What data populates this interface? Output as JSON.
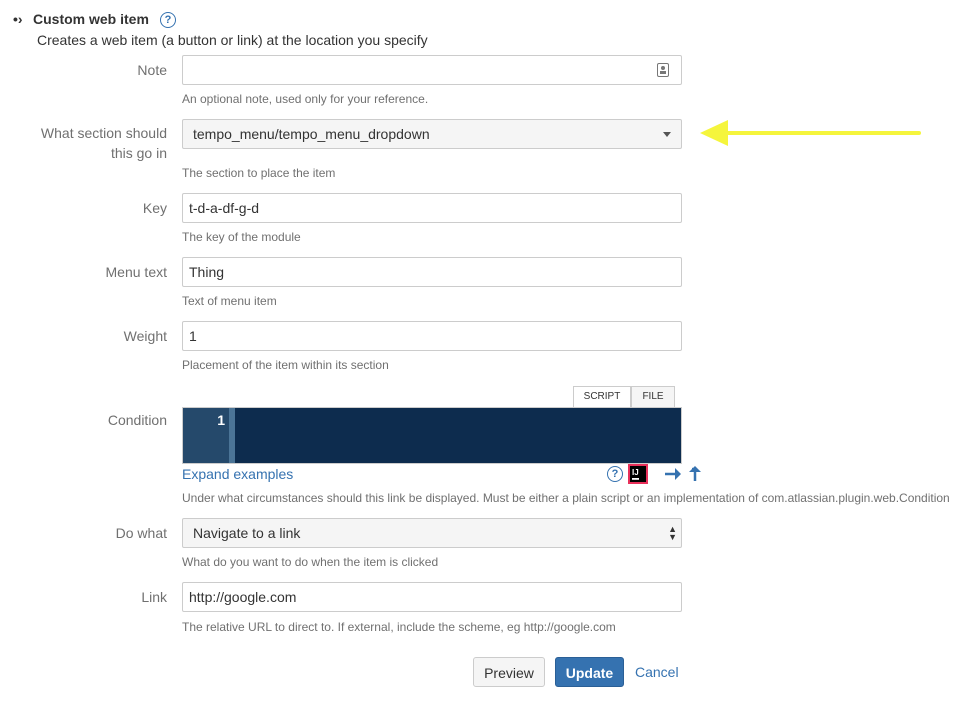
{
  "section": {
    "title": "Custom web item",
    "description": "Creates a web item (a button or link) at the location you specify",
    "help_glyph": "?"
  },
  "fields": {
    "note": {
      "label": "Note",
      "value": "",
      "description": "An optional note, used only for your reference."
    },
    "section": {
      "label_line1": "What section should",
      "label_line2": "this go in",
      "value": "tempo_menu/tempo_menu_dropdown",
      "description": "The section to place the item"
    },
    "key": {
      "label": "Key",
      "value": "t-d-a-df-g-d",
      "description": "The key of the module"
    },
    "menu_text": {
      "label": "Menu text",
      "value": "Thing",
      "description": "Text of menu item"
    },
    "weight": {
      "label": "Weight",
      "value": "1",
      "description": "Placement of the item within its section"
    },
    "condition": {
      "label": "Condition",
      "tabs": [
        "SCRIPT",
        "FILE"
      ],
      "line_number": "1",
      "expand_examples": "Expand examples",
      "description": "Under what circumstances should this link be displayed. Must be either a plain script or an implementation of com.atlassian.plugin.web.Condition"
    },
    "do_what": {
      "label": "Do what",
      "value": "Navigate to a link",
      "description": "What do you want to do when the item is clicked"
    },
    "link": {
      "label": "Link",
      "value": "http://google.com",
      "description": "The relative URL to direct to. If external, include the scheme, eg http://google.com"
    }
  },
  "buttons": {
    "preview": "Preview",
    "update": "Update",
    "cancel": "Cancel"
  },
  "icons": [
    "collapse-arrow-icon",
    "help-icon",
    "contacts-icon",
    "chevron-down-icon",
    "intellij-icon",
    "arrow-right-icon",
    "arrow-return-icon"
  ],
  "colors": {
    "accent": "#3572b0",
    "editor_bg": "#0d2c4e",
    "annotation_arrow": "#f5f53c"
  }
}
